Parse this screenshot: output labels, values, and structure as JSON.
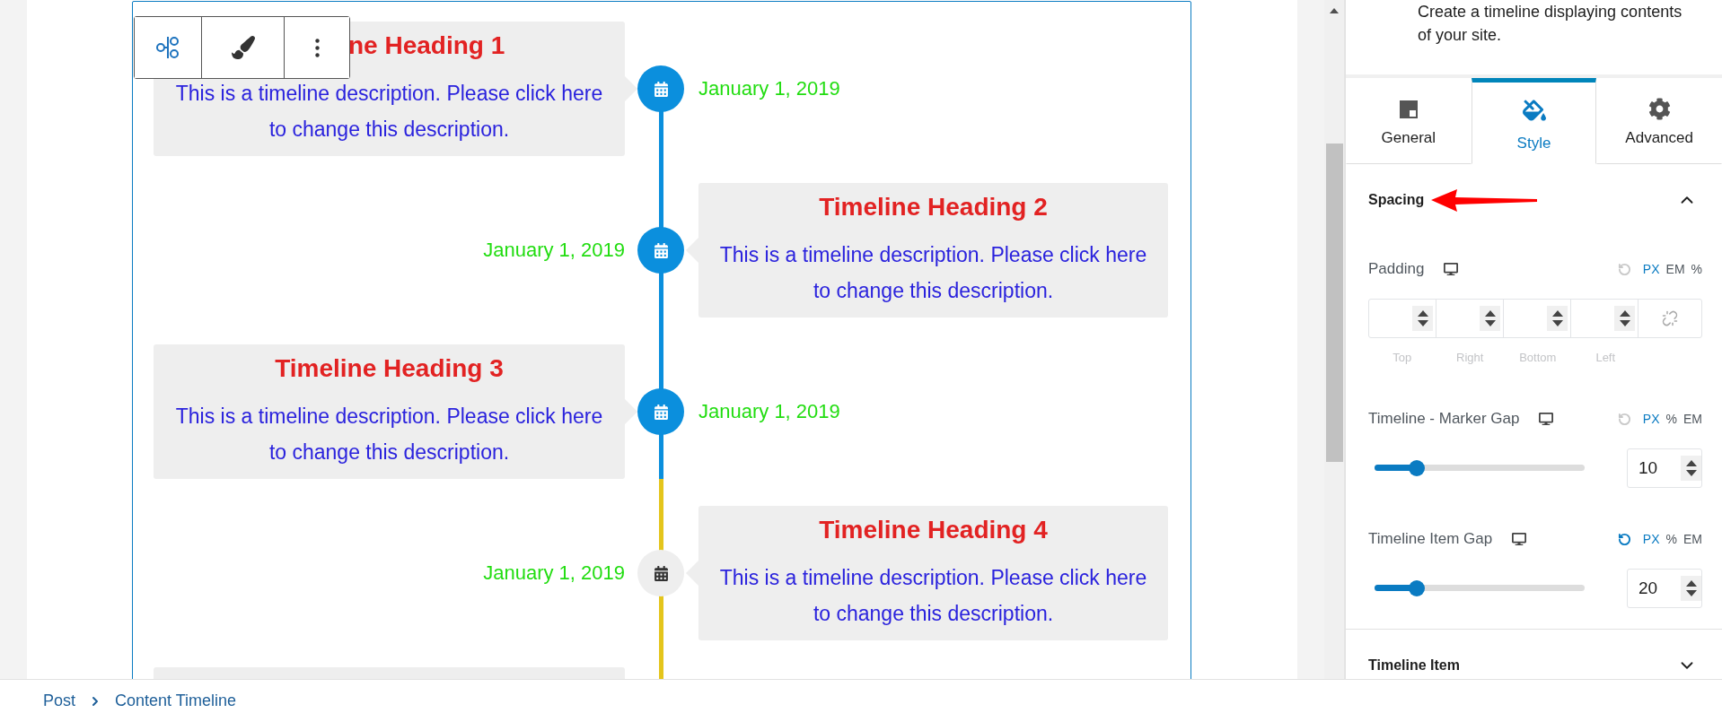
{
  "toolbar": {
    "buttons": [
      {
        "kind": "flow"
      },
      {
        "kind": "brush"
      },
      {
        "kind": "more"
      }
    ]
  },
  "timeline": {
    "items": [
      {
        "heading": "ne Heading 1",
        "description": "This is a timeline description. Please click here to change this description.",
        "date": "January 1, 2019",
        "active": true
      },
      {
        "heading": "Timeline Heading 2",
        "description": "This is a timeline description. Please click here to change this description.",
        "date": "January 1, 2019",
        "active": true
      },
      {
        "heading": "Timeline Heading 3",
        "description": "This is a timeline description. Please click here to change this description.",
        "date": "January 1, 2019",
        "active": true
      },
      {
        "heading": "Timeline Heading 4",
        "description": "This is a timeline description. Please click here to change this description.",
        "date": "January 1, 2019",
        "active": false
      },
      {
        "active": false
      }
    ]
  },
  "sidebar": {
    "description": "Create a timeline displaying contents of your site.",
    "tabs": [
      {
        "label": "General",
        "kind": "layout",
        "selected": false
      },
      {
        "label": "Style",
        "kind": "style",
        "selected": true
      },
      {
        "label": "Advanced",
        "kind": "gear",
        "selected": false
      }
    ],
    "sections": [
      {
        "title": "Spacing",
        "expanded": true,
        "annotation_arrow": true,
        "controls": [
          {
            "kind": "box",
            "label": "Padding",
            "reset_active": false,
            "units": [
              {
                "label": "PX",
                "selected": true
              },
              {
                "label": "EM",
                "selected": false
              },
              {
                "label": "%",
                "selected": false
              }
            ],
            "sides": [
              "Top",
              "Right",
              "Bottom",
              "Left"
            ]
          },
          {
            "kind": "slider",
            "label": "Timeline - Marker Gap",
            "reset_active": false,
            "units": [
              {
                "label": "PX",
                "selected": true
              },
              {
                "label": "%",
                "selected": false
              },
              {
                "label": "EM",
                "selected": false
              }
            ],
            "level": 0.2,
            "value": "10"
          },
          {
            "kind": "slider",
            "label": "Timeline Item Gap",
            "reset_active": true,
            "units": [
              {
                "label": "PX",
                "selected": true
              },
              {
                "label": "%",
                "selected": false
              },
              {
                "label": "EM",
                "selected": false
              }
            ],
            "level": 0.2,
            "value": "20"
          }
        ]
      },
      {
        "title": "Timeline Item",
        "expanded": false,
        "annotation_arrow": false
      }
    ]
  },
  "breadcrumb": [
    "Post",
    "Content Timeline"
  ]
}
